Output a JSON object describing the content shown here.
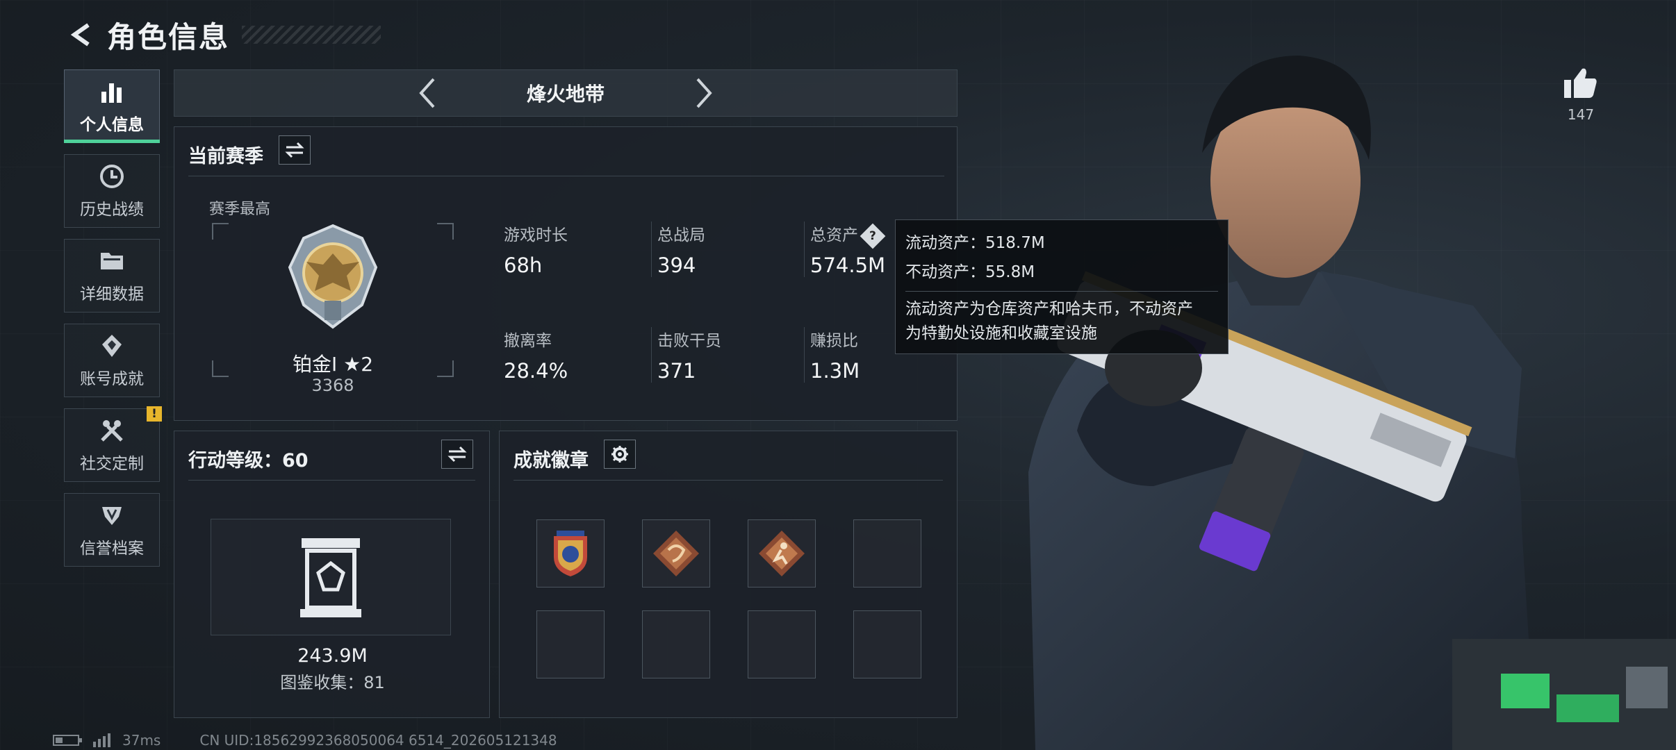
{
  "header": {
    "title": "角色信息"
  },
  "nav": {
    "items": [
      {
        "label": "个人信息",
        "icon": "bar-chart-icon",
        "active": true
      },
      {
        "label": "历史战绩",
        "icon": "history-clock-icon"
      },
      {
        "label": "详细数据",
        "icon": "folder-icon"
      },
      {
        "label": "账号成就",
        "icon": "achievement-icon"
      },
      {
        "label": "社交定制",
        "icon": "tools-icon",
        "badge": "!"
      },
      {
        "label": "信誉档案",
        "icon": "reputation-icon"
      }
    ]
  },
  "mode": {
    "name": "烽火地带"
  },
  "season": {
    "title": "当前赛季",
    "best_label": "赛季最高",
    "rank_name": "铂金I ★2",
    "rank_score": "3368",
    "stats": [
      {
        "label": "游戏时长",
        "value": "68h"
      },
      {
        "label": "总战局",
        "value": "394"
      },
      {
        "label": "总资产",
        "value": "574.5M",
        "help": "?"
      },
      {
        "label": "撤离率",
        "value": "28.4%"
      },
      {
        "label": "击败干员",
        "value": "371"
      },
      {
        "label": "赚损比",
        "value": "1.3M"
      }
    ]
  },
  "tooltip": {
    "liquid": "流动资产：518.7M",
    "fixed": "不动资产：55.8M",
    "desc_1": "流动资产为仓库资产和哈夫币，不动资产",
    "desc_2": "为特勤处设施和收藏室设施"
  },
  "level": {
    "title": "行动等级：60",
    "collection_value": "243.9M",
    "collection_count": "图鉴收集：81"
  },
  "badges": {
    "title": "成就徽章"
  },
  "like": {
    "count": "147"
  },
  "footer": {
    "ping": "37ms",
    "uid": "CN UID:18562992368050064 6514_202605121348"
  },
  "colors": {
    "accent": "#4fd19a",
    "warning": "#e8b62c",
    "gold": "#c9a35a",
    "purple": "#6a3ad0"
  }
}
